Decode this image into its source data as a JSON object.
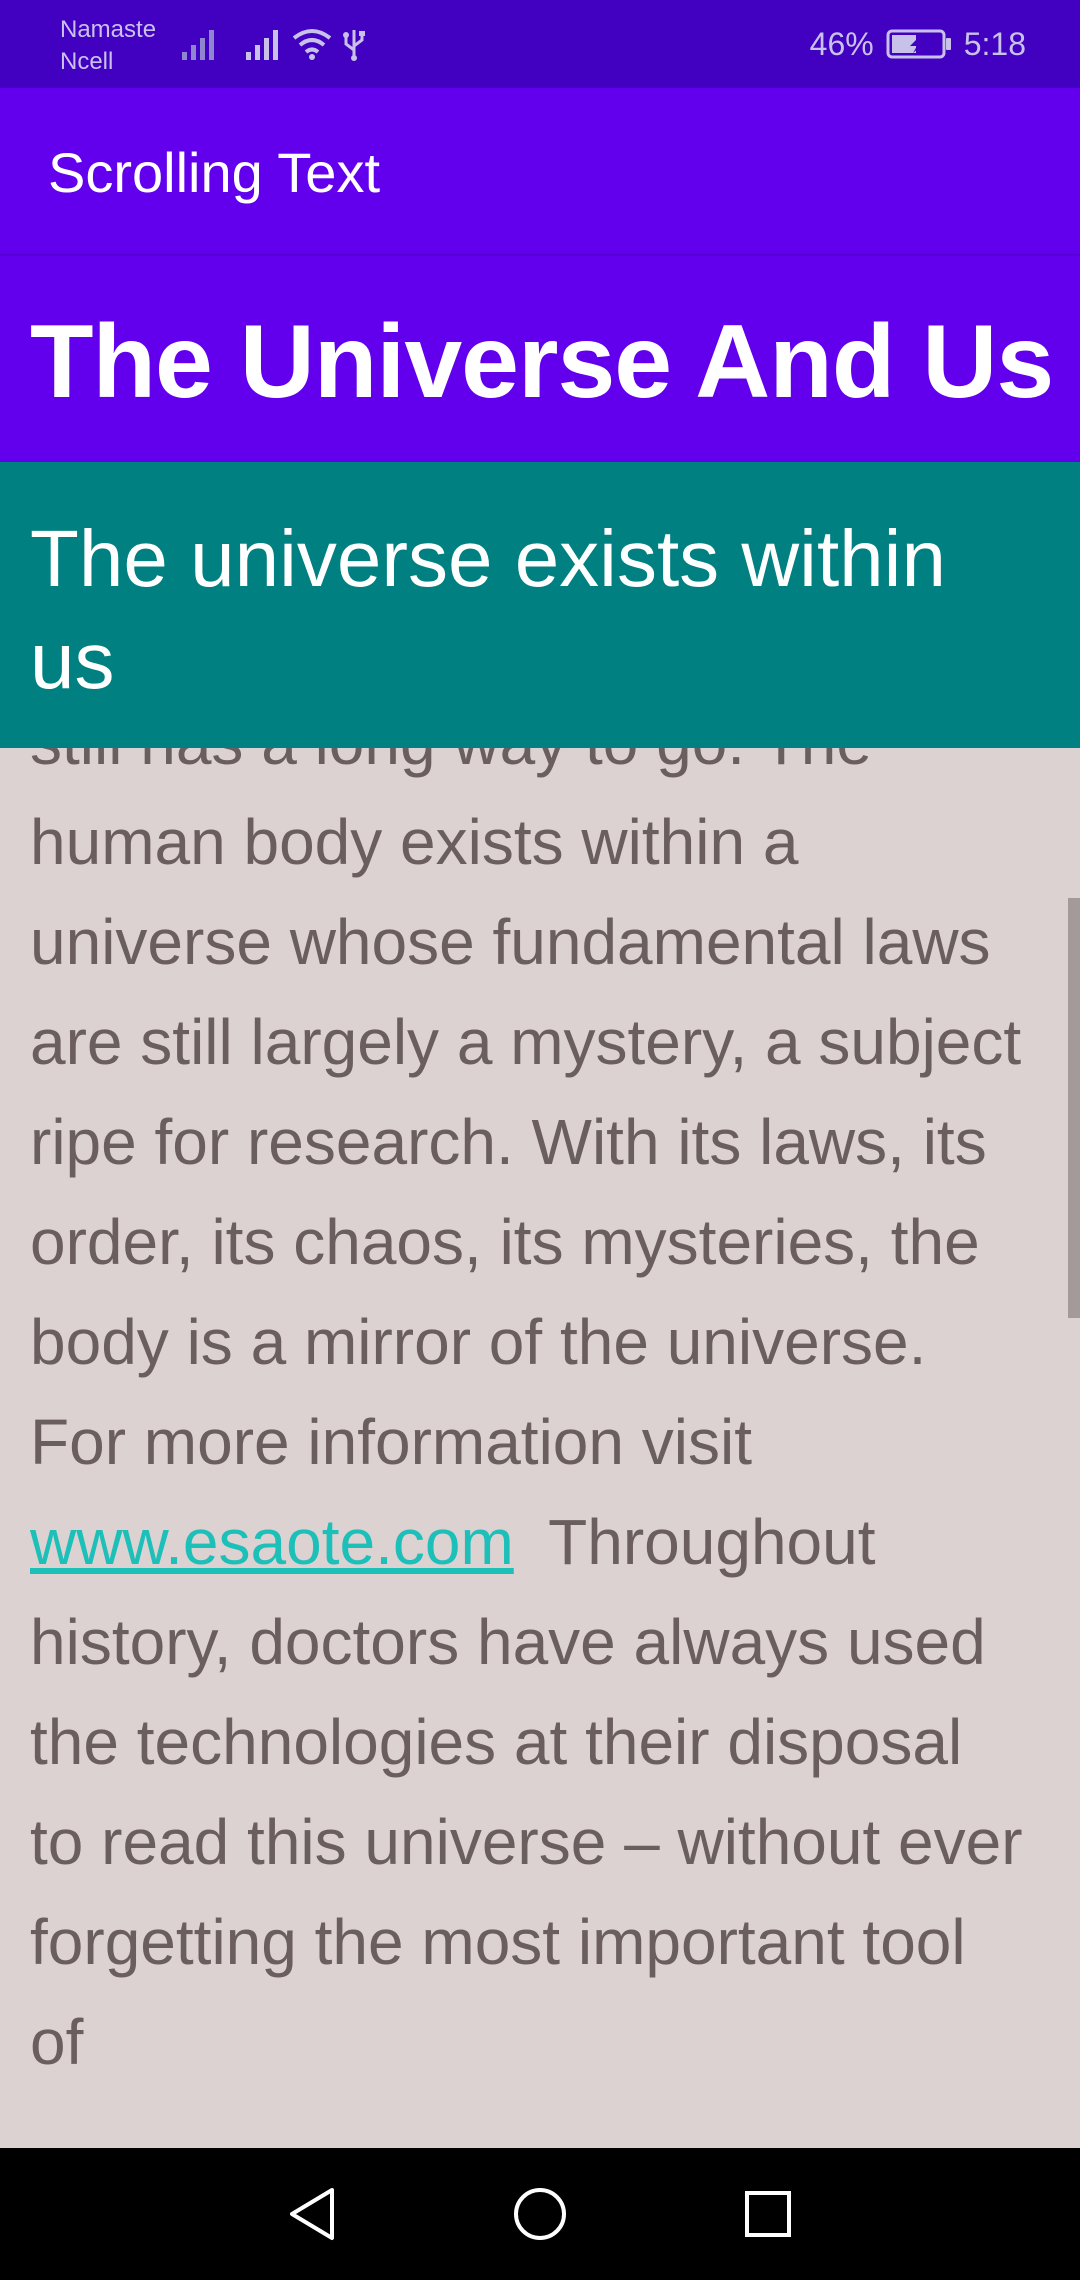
{
  "status_bar": {
    "carrier_line1": "Namaste",
    "carrier_line2": "Ncell",
    "battery_percent": "46%",
    "time": "5:18",
    "icons": [
      "signal-icon",
      "signal-icon",
      "wifi-icon",
      "usb-icon",
      "battery-charging-icon"
    ]
  },
  "app_bar": {
    "title": "Scrolling Text"
  },
  "heading": "The Universe And Us",
  "subheading": "The universe exists within us",
  "article": {
    "partial_top_line": "still has a long way to go. The",
    "text_before_link": "human body exists within a universe whose fundamental laws are still largely a mystery, a subject ripe for research. With its laws, its order, its chaos, its mysteries, the body is a mirror of the universe. For more information visit ",
    "link_text": "www.esaote.com",
    "text_after_link": "  Throughout history, doctors have always used the technologies at their disposal to read this universe – without ever forgetting the most important tool of"
  },
  "nav_bar": {
    "buttons": [
      "back-icon",
      "home-icon",
      "recents-icon"
    ]
  },
  "colors": {
    "status_bar": "#4200c0",
    "app_bar": "#6200ee",
    "subheading_background": "#008080",
    "article_background": "#dcd2d2",
    "article_text": "#6b5e5e",
    "link": "#1cc0b8"
  }
}
